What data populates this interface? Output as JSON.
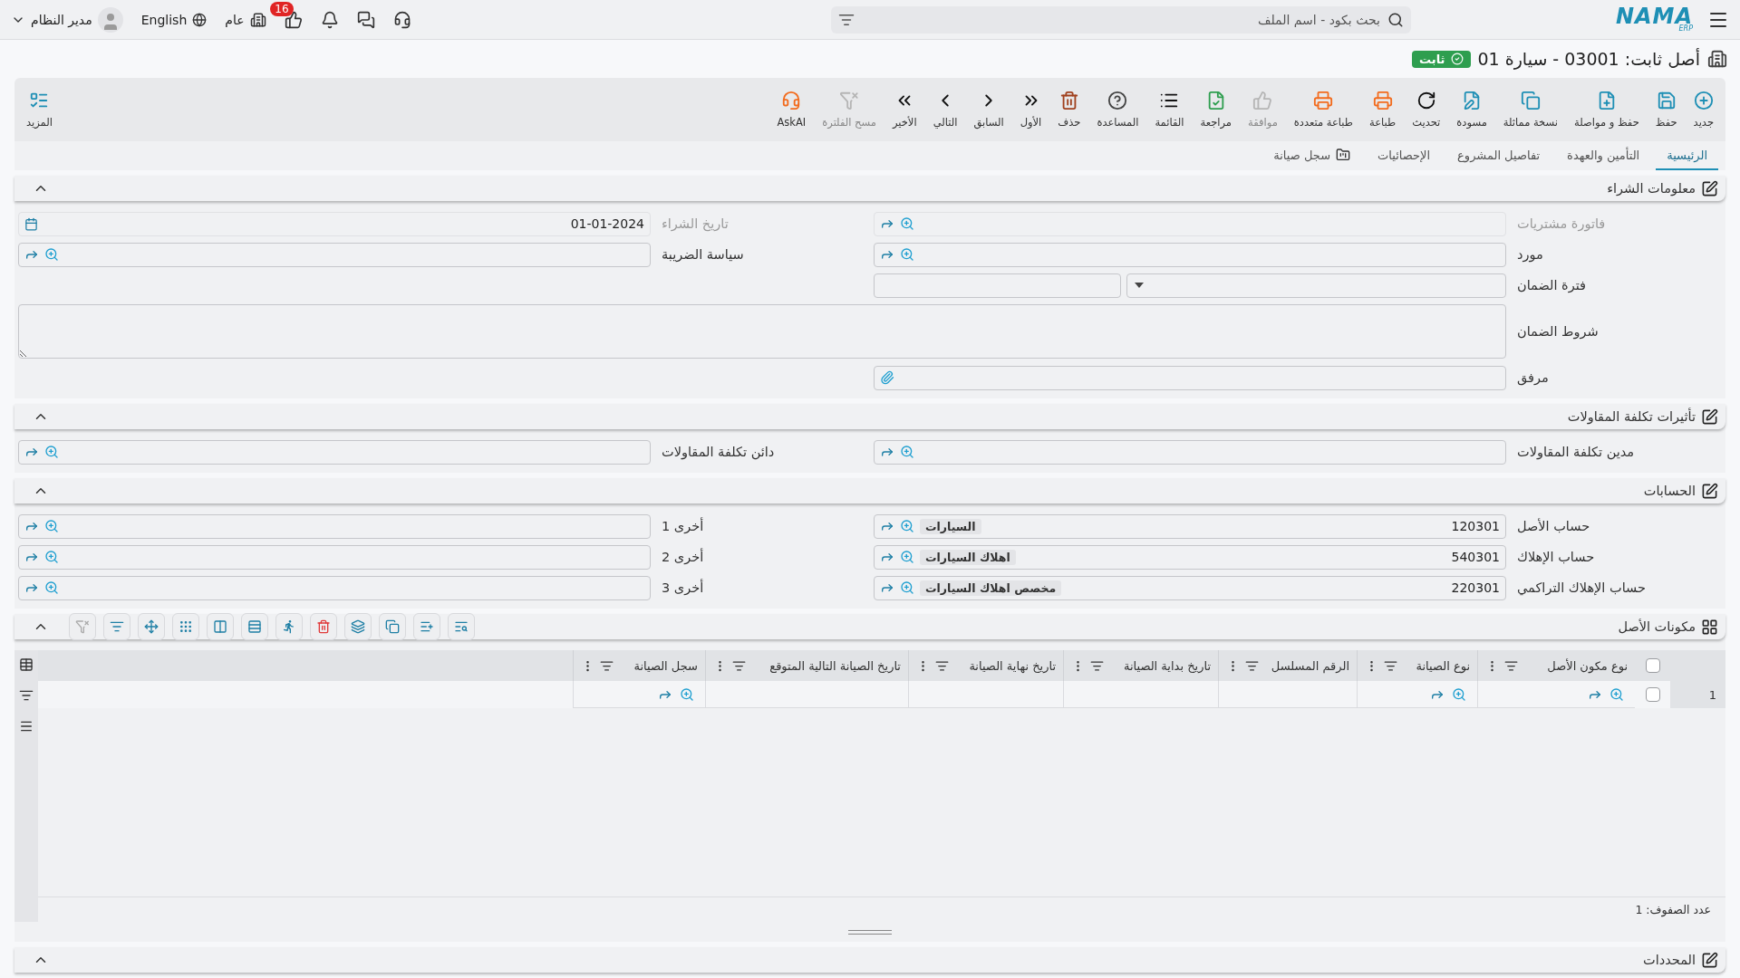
{
  "top_bar": {
    "logo": "NAMA",
    "logo_sub": "ERP",
    "search": {
      "placeholder": "بحث بكود - اسم الملف"
    },
    "notifications_badge": "16",
    "branch": "عام",
    "language": "English",
    "user": "مدير النظام"
  },
  "title": "أصل ثابت: 03001 - سيارة 01",
  "status": "ثابت",
  "toolbar": [
    {
      "kind": "new",
      "label": "جديد",
      "disabled": false
    },
    {
      "kind": "save",
      "label": "حفظ",
      "disabled": false
    },
    {
      "kind": "save_continue",
      "label": "حفظ و مواصلة",
      "disabled": false
    },
    {
      "kind": "duplicate",
      "label": "نسخة مماثلة",
      "disabled": false
    },
    {
      "kind": "draft",
      "label": "مسودة",
      "disabled": false
    },
    {
      "kind": "refresh",
      "label": "تحديث",
      "disabled": false
    },
    {
      "kind": "print",
      "label": "طباعة",
      "disabled": false
    },
    {
      "kind": "multi_print",
      "label": "طباعة متعددة",
      "disabled": false
    },
    {
      "kind": "approve",
      "label": "موافقة",
      "disabled": true
    },
    {
      "kind": "review",
      "label": "مراجعة",
      "disabled": false
    },
    {
      "kind": "list",
      "label": "القائمة",
      "disabled": false
    },
    {
      "kind": "help",
      "label": "المساعدة",
      "disabled": false
    },
    {
      "kind": "delete",
      "label": "حذف",
      "disabled": false
    },
    {
      "kind": "first",
      "label": "الأول",
      "disabled": false
    },
    {
      "kind": "prev",
      "label": "السابق",
      "disabled": false
    },
    {
      "kind": "next",
      "label": "التالي",
      "disabled": false
    },
    {
      "kind": "last",
      "label": "الأخير",
      "disabled": false
    },
    {
      "kind": "clear_filter",
      "label": "مسح الفلترة",
      "disabled": true
    },
    {
      "kind": "ask_ai",
      "label": "AskAI",
      "disabled": false
    }
  ],
  "more": {
    "label": "المزيد"
  },
  "tabs": [
    {
      "label": "الرئيسية",
      "selected": true
    },
    {
      "label": "التأمين والعهدة",
      "selected": false
    },
    {
      "label": "تفاصيل المشروع",
      "selected": false
    },
    {
      "label": "الإحصائيات",
      "selected": false
    },
    {
      "label": "سجل صيانة",
      "selected": false,
      "kind": "folder"
    }
  ],
  "sections": [
    {
      "kind": "form",
      "title": "معلومات الشراء",
      "expanded": true,
      "rows": [
        [
          {
            "kind": "lookup",
            "label": "فاتورة مشتريات",
            "disabled": true
          },
          {
            "kind": "date",
            "label": "تاريخ الشراء",
            "value": "01-01-2024",
            "disabled": true
          }
        ],
        [
          {
            "kind": "lookup",
            "label": "مورد",
            "disabled": false
          },
          {
            "kind": "lookup",
            "label": "سياسة الضريبة",
            "disabled": false
          }
        ],
        [
          {
            "kind": "period",
            "label": "فترة الضمان",
            "disabled": false
          }
        ],
        [
          {
            "kind": "textarea",
            "label": "شروط الضمان",
            "disabled": false
          }
        ],
        [
          {
            "kind": "attachment",
            "label": "مرفق",
            "disabled": false
          }
        ]
      ]
    },
    {
      "kind": "form",
      "title": "تأثيرات تكلفة المقاولات",
      "expanded": true,
      "rows": [
        [
          {
            "kind": "lookup",
            "label": "مدين تكلفة المقاولات",
            "disabled": false
          },
          {
            "kind": "lookup",
            "label": "دائن تكلفة المقاولات",
            "disabled": false
          }
        ]
      ]
    },
    {
      "kind": "form",
      "title": "الحسابات",
      "expanded": true,
      "rows": [
        [
          {
            "kind": "account",
            "label": "حساب الأصل",
            "value": "120301",
            "tag": "السيارات",
            "disabled": false
          },
          {
            "kind": "lookup",
            "label": "أخرى 1",
            "disabled": false
          }
        ],
        [
          {
            "kind": "account",
            "label": "حساب الإهلاك",
            "value": "540301",
            "tag": "اهلاك السيارات",
            "disabled": false
          },
          {
            "kind": "lookup",
            "label": "أخرى 2",
            "disabled": false
          }
        ],
        [
          {
            "kind": "account",
            "label": "حساب الإهلاك التراكمي",
            "value": "220301",
            "tag": "مخصص اهلاك السيارات",
            "disabled": false
          },
          {
            "kind": "lookup",
            "label": "أخرى 3",
            "disabled": false
          }
        ]
      ]
    },
    {
      "kind": "grid",
      "title": "مكونات الأصل",
      "expanded": true,
      "tools": [
        {
          "kind": "search_list",
          "disabled": false
        },
        {
          "kind": "add_row",
          "disabled": false
        },
        {
          "kind": "copy",
          "disabled": false
        },
        {
          "kind": "layers",
          "disabled": false
        },
        {
          "kind": "delete",
          "disabled": false
        },
        {
          "kind": "run",
          "disabled": false
        },
        {
          "kind": "rows",
          "disabled": false
        },
        {
          "kind": "columns",
          "disabled": false
        },
        {
          "kind": "dots",
          "disabled": false
        },
        {
          "kind": "move",
          "disabled": false
        },
        {
          "kind": "filter",
          "disabled": false
        },
        {
          "kind": "clear_filter",
          "disabled": true
        }
      ],
      "all_checked": false,
      "columns": [
        "نوع مكون الأصل",
        "نوع الصيانة",
        "الرقم المسلسل",
        "تاريخ بداية الصيانة",
        "تاريخ نهاية الصيانة",
        "تاريخ الصيانة التالية المتوقع",
        "سجل الصيانة"
      ],
      "rows": [
        {
          "number": "1",
          "checked": false,
          "cells": [
            {
              "kind": "lookup"
            },
            {
              "kind": "lookup"
            },
            {
              "kind": "empty"
            },
            {
              "kind": "empty"
            },
            {
              "kind": "empty"
            },
            {
              "kind": "empty"
            },
            {
              "kind": "lookup"
            }
          ]
        }
      ],
      "footer": "عدد الصفوف: 1"
    },
    {
      "kind": "form",
      "title": "المحددات",
      "expanded": true
    }
  ]
}
